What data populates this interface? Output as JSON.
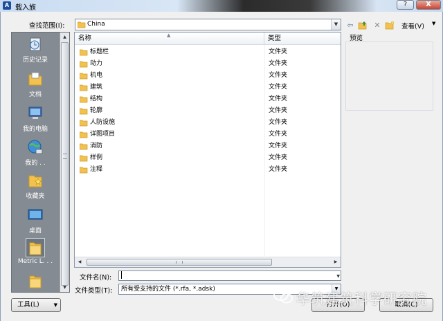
{
  "window": {
    "title": "载入族",
    "help_glyph": "?",
    "close_glyph": "X"
  },
  "lookin": {
    "label": "查找范围(I):",
    "value": "China"
  },
  "toolbar": {
    "view_label": "查看(V)",
    "icons": [
      "back-icon",
      "up-folder-icon",
      "delete-icon",
      "new-folder-icon"
    ]
  },
  "places": [
    {
      "label": "历史记录",
      "icon": "history-icon"
    },
    {
      "label": "文档",
      "icon": "documents-icon"
    },
    {
      "label": "我的电脑",
      "icon": "computer-icon"
    },
    {
      "label": "我的 . .",
      "icon": "network-icon"
    },
    {
      "label": "收藏夹",
      "icon": "favorites-icon"
    },
    {
      "label": "桌面",
      "icon": "desktop-icon"
    },
    {
      "label": "Metric L. . .",
      "icon": "folder-icon"
    },
    {
      "label": "",
      "icon": "folder-icon"
    }
  ],
  "filelist": {
    "headers": {
      "name": "名称",
      "type": "类型"
    },
    "rows": [
      {
        "name": "标题栏",
        "type": "文件夹"
      },
      {
        "name": "动力",
        "type": "文件夹"
      },
      {
        "name": "机电",
        "type": "文件夹"
      },
      {
        "name": "建筑",
        "type": "文件夹"
      },
      {
        "name": "结构",
        "type": "文件夹"
      },
      {
        "name": "轮廓",
        "type": "文件夹"
      },
      {
        "name": "人防设施",
        "type": "文件夹"
      },
      {
        "name": "详图项目",
        "type": "文件夹"
      },
      {
        "name": "消防",
        "type": "文件夹"
      },
      {
        "name": "样例",
        "type": "文件夹"
      },
      {
        "name": "注释",
        "type": "文件夹"
      }
    ]
  },
  "preview": {
    "label": "预览"
  },
  "filename": {
    "label": "文件名(N):",
    "value": ""
  },
  "filetype": {
    "label": "文件类型(T):",
    "value": "所有受支持的文件 (*.rfa, *.adsk)"
  },
  "buttons": {
    "tools": "工具(L)",
    "open": "打开(O)",
    "cancel": "取消(C)"
  },
  "watermark": {
    "text": "华筑建筑科学研究院"
  },
  "colors": {
    "places_bg": "#858b92",
    "folder": "#f2c14e",
    "title_accent": "#1d4f9c"
  }
}
